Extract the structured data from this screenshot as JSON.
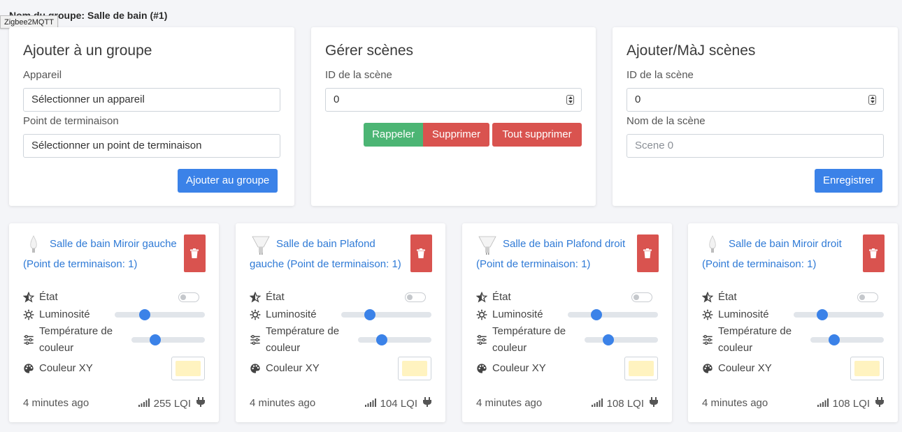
{
  "header": {
    "group_name": "Nom du groupe: Salle de bain (#1)",
    "tooltip": "Zigbee2MQTT"
  },
  "add_to_group": {
    "title": "Ajouter à un groupe",
    "device_label": "Appareil",
    "device_value": "Sélectionner un appareil",
    "endpoint_label": "Point de terminaison",
    "endpoint_value": "Sélectionner un point de terminaison",
    "submit_label": "Ajouter au groupe"
  },
  "manage_scenes": {
    "title": "Gérer scènes",
    "scene_id_label": "ID de la scène",
    "scene_id_value": "0",
    "recall_label": "Rappeler",
    "remove_label": "Supprimer",
    "remove_all_label": "Tout supprimer"
  },
  "add_update_scenes": {
    "title": "Ajouter/MàJ scènes",
    "scene_id_label": "ID de la scène",
    "scene_id_value": "0",
    "scene_name_label": "Nom de la scène",
    "scene_name_placeholder": "Scene 0",
    "save_label": "Enregistrer"
  },
  "common_labels": {
    "state": "État",
    "brightness": "Luminosité",
    "color_temp_line1": "Température de",
    "color_temp_line2": "couleur",
    "color_xy": "Couleur XY"
  },
  "devices": [
    {
      "line1": "Salle de bain Miroir gauche",
      "line2": "(Point de terminaison: 1)",
      "bulb": "candle-bulb-icon",
      "state_on": false,
      "brightness": 0.33,
      "color_temp": 0.32,
      "color": "#fff3c0",
      "last_seen": "4 minutes ago",
      "lqi": "255 LQI"
    },
    {
      "line1": "Salle de bain Plafond",
      "line2": "gauche (Point de terminaison: 1)",
      "bulb": "spot-bulb-icon",
      "state_on": false,
      "brightness": 0.32,
      "color_temp": 0.32,
      "color": "#fff3c0",
      "last_seen": "4 minutes ago",
      "lqi": "104 LQI"
    },
    {
      "line1": "Salle de bain Plafond droit",
      "line2": "(Point de terminaison: 1)",
      "bulb": "spot-bulb-icon",
      "state_on": false,
      "brightness": 0.32,
      "color_temp": 0.32,
      "color": "#fff3c0",
      "last_seen": "4 minutes ago",
      "lqi": "108 LQI"
    },
    {
      "line1": "Salle de bain Miroir droit",
      "line2": "(Point de terminaison: 1)",
      "bulb": "candle-bulb-icon",
      "state_on": false,
      "brightness": 0.32,
      "color_temp": 0.32,
      "color": "#fff3c0",
      "last_seen": "4 minutes ago",
      "lqi": "108 LQI"
    }
  ]
}
